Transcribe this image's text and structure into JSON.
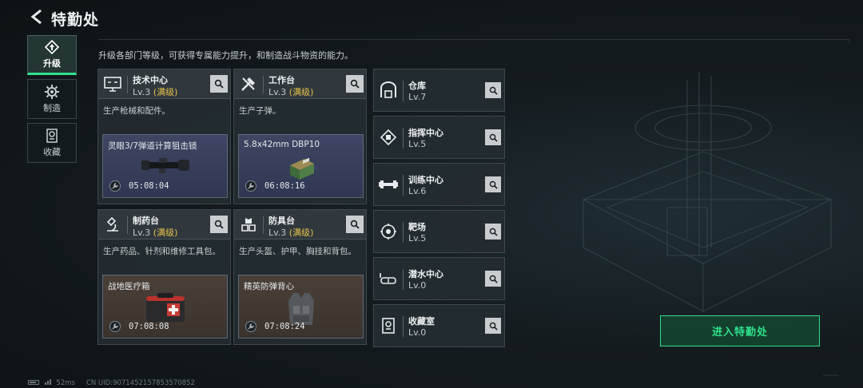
{
  "header": {
    "title": "特勤处"
  },
  "subtitle": "升级各部门等级，可获得专属能力提升，和制造战斗物资的能力。",
  "nav": [
    {
      "label": "升级",
      "icon": "upgrade-icon",
      "active": true
    },
    {
      "label": "制造",
      "icon": "gear-icon",
      "active": false
    },
    {
      "label": "收藏",
      "icon": "trophy-icon",
      "active": false
    }
  ],
  "cards": [
    {
      "name": "技术中心",
      "level": "Lv.3",
      "max": "(满级)",
      "desc": "生产枪械和配件。",
      "product": "灵眼3/7弹道计算狙击镜",
      "time": "05:08:04",
      "icon": "monitor-icon",
      "item_icon": "scope-icon",
      "bg": "blue"
    },
    {
      "name": "工作台",
      "level": "Lv.3",
      "max": "(满级)",
      "desc": "生产子弹。",
      "product": "5.8x42mm DBP10",
      "time": "06:08:16",
      "icon": "tools-icon",
      "item_icon": "ammo-box-icon",
      "bg": "blue"
    },
    {
      "name": "制药台",
      "level": "Lv.3",
      "max": "(满级)",
      "desc": "生产药品、针剂和维修工具包。",
      "product": "战地医疗箱",
      "time": "07:08:08",
      "icon": "microscope-icon",
      "item_icon": "medkit-icon",
      "bg": "brown"
    },
    {
      "name": "防具台",
      "level": "Lv.3",
      "max": "(满级)",
      "desc": "生产头盔、护甲、胸挂和背包。",
      "product": "精英防弹背心",
      "time": "07:08:24",
      "icon": "armor-icon",
      "item_icon": "vest-icon",
      "bg": "brown"
    }
  ],
  "rows": [
    {
      "name": "仓库",
      "level": "Lv.7",
      "icon": "warehouse-icon"
    },
    {
      "name": "指挥中心",
      "level": "Lv.5",
      "icon": "chip-icon"
    },
    {
      "name": "训练中心",
      "level": "Lv.6",
      "icon": "dumbbell-icon"
    },
    {
      "name": "靶场",
      "level": "Lv.5",
      "icon": "target-icon"
    },
    {
      "name": "潜水中心",
      "level": "Lv.0",
      "icon": "diving-mask-icon"
    },
    {
      "name": "收藏室",
      "level": "Lv.0",
      "icon": "trophy-icon"
    }
  ],
  "enter_button": "进入特勤处",
  "footer": {
    "ping": "52ms",
    "uid": "CN UID:9071452157853570852"
  },
  "colors": {
    "accent": "#2ee08b",
    "max_level": "#e8c24a"
  }
}
